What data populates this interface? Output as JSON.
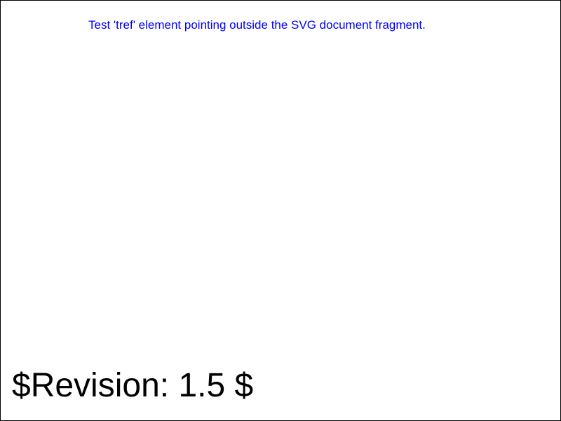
{
  "colors": {
    "test_text": "#0000ff",
    "revision_text": "#000000",
    "border": "#000000",
    "background": "#ffffff"
  },
  "content": {
    "test_text": "Test 'tref' element pointing outside the SVG document fragment.",
    "revision_text": "$Revision: 1.5 $"
  }
}
